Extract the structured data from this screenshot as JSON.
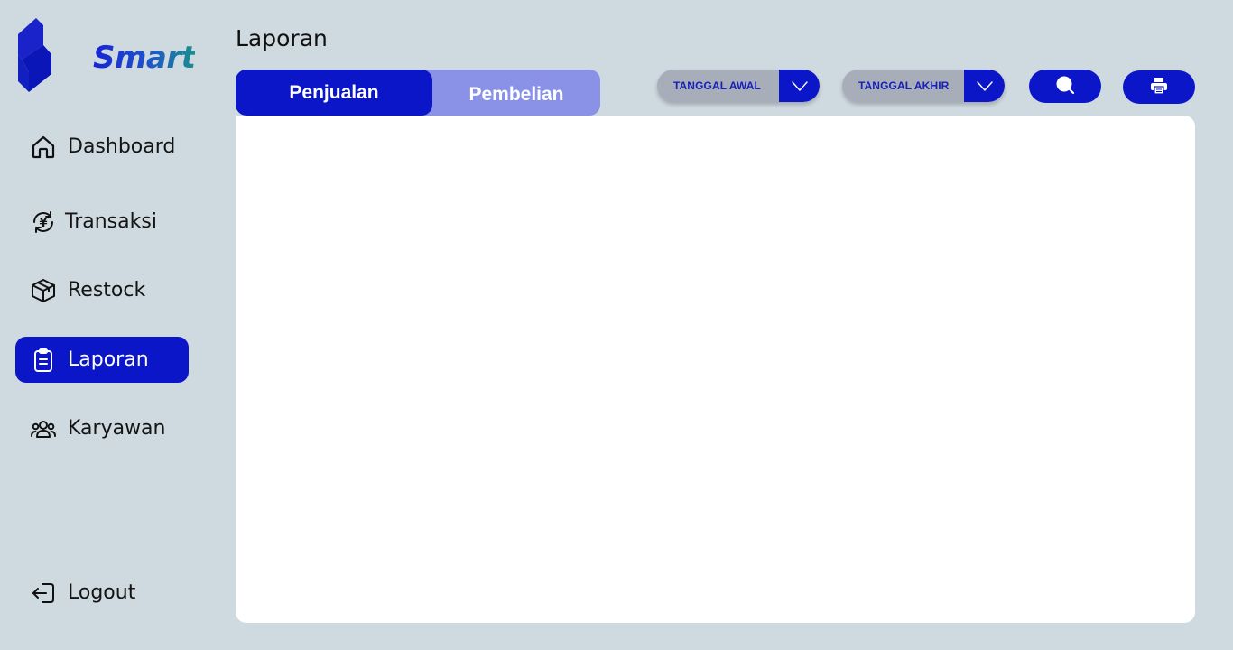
{
  "app": {
    "brand_name": "Smart",
    "brand_colors": {
      "primary": "#0b16c8",
      "gradient_end": "#1a8f8f"
    }
  },
  "sidebar": {
    "items": [
      {
        "label": "Dashboard",
        "icon": "home-icon",
        "active": false
      },
      {
        "label": "Transaksi",
        "icon": "currency-exchange-icon",
        "active": false
      },
      {
        "label": "Restock",
        "icon": "package-icon",
        "active": false
      },
      {
        "label": "Laporan",
        "icon": "clipboard-icon",
        "active": true
      },
      {
        "label": "Karyawan",
        "icon": "users-icon",
        "active": false
      }
    ],
    "logout": {
      "label": "Logout",
      "icon": "logout-icon"
    }
  },
  "header": {
    "title": "Laporan"
  },
  "tabs": [
    {
      "label": "Penjualan",
      "active": true
    },
    {
      "label": "Pembelian",
      "active": false
    }
  ],
  "filters": {
    "start_date": {
      "label": "TANGGAL AWAL",
      "icon": "chevron-down-icon"
    },
    "end_date": {
      "label": "TANGGAL AKHIR",
      "icon": "chevron-down-icon"
    }
  },
  "actions": {
    "search": {
      "icon": "search-icon"
    },
    "print": {
      "icon": "printer-icon"
    }
  },
  "colors": {
    "background": "#cfd9e0",
    "accent": "#0b16c8",
    "tab_inactive": "#8a92e8",
    "date_picker_bg": "#a8aeb9",
    "panel": "#ffffff"
  }
}
